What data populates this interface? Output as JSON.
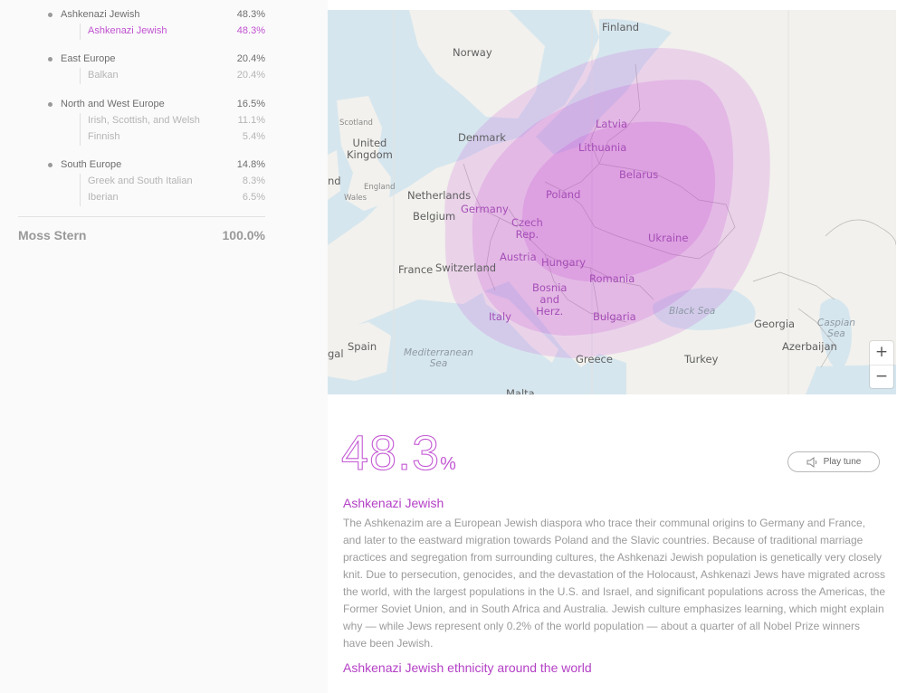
{
  "breakdown": {
    "regions": [
      {
        "name": "Ashkenazi Jewish",
        "pct": "48.3%",
        "subs": [
          {
            "name": "Ashkenazi Jewish",
            "pct": "48.3%",
            "active": true
          }
        ]
      },
      {
        "name": "East Europe",
        "pct": "20.4%",
        "subs": [
          {
            "name": "Balkan",
            "pct": "20.4%"
          }
        ]
      },
      {
        "name": "North and West Europe",
        "pct": "16.5%",
        "subs": [
          {
            "name": "Irish, Scottish, and Welsh",
            "pct": "11.1%"
          },
          {
            "name": "Finnish",
            "pct": "5.4%"
          }
        ]
      },
      {
        "name": "South Europe",
        "pct": "14.8%",
        "subs": [
          {
            "name": "Greek and South Italian",
            "pct": "8.3%"
          },
          {
            "name": "Iberian",
            "pct": "6.5%"
          }
        ]
      }
    ],
    "total": {
      "name": "Moss Stern",
      "pct": "100.0%"
    }
  },
  "map": {
    "labels": {
      "finland": "Finland",
      "norway": "Norway",
      "scotland": "Scotland",
      "united_kingdom": "United\nKingdom",
      "ireland_partial": "nd",
      "england": "England",
      "wales": "Wales",
      "denmark": "Denmark",
      "latvia": "Latvia",
      "lithuania": "Lithuania",
      "belarus": "Belarus",
      "netherlands": "Netherlands",
      "belgium": "Belgium",
      "germany": "Germany",
      "poland": "Poland",
      "czech_rep": "Czech\nRep.",
      "ukraine": "Ukraine",
      "austria": "Austria",
      "hungary": "Hungary",
      "france": "France",
      "switzerland": "Switzerland",
      "romania": "Romania",
      "bosnia": "Bosnia\nand\nHerz.",
      "italy": "Italy",
      "bulgaria": "Bulgaria",
      "black_sea": "Black Sea",
      "georgia": "Georgia",
      "caspian_sea": "Caspian\nSea",
      "azerbaijan": "Azerbaijan",
      "spain": "Spain",
      "portugal_partial": "gal",
      "mediterranean_sea": "Mediterranean\nSea",
      "greece": "Greece",
      "turkey": "Turkey",
      "malta_partial": "Malta"
    },
    "zoom_in": "+",
    "zoom_out": "−",
    "highlight_color": "#c84fd8"
  },
  "detail": {
    "percent_number": "48.3",
    "percent_unit": "%",
    "play_tune_label": "Play tune",
    "title": "Ashkenazi Jewish",
    "description": "The Ashkenazim are a European Jewish diaspora who trace their communal origins to Germany and France, and later to the eastward migration towards Poland and the Slavic countries. Because of traditional marriage practices and segregation from surrounding cultures, the Ashkenazi Jewish population is genetically very closely knit. Due to persecution, genocides, and the devastation of the Holocaust, Ashkenazi Jews have migrated across the world, with the largest populations in the U.S. and Israel, and significant populations across the Americas, the Former Soviet Union, and in South Africa and Australia. Jewish culture emphasizes learning, which might explain why — while Jews represent only 0.2% of the world population — about a quarter of all Nobel Prize winners have been Jewish.",
    "world_link": "Ashkenazi Jewish ethnicity around the world"
  },
  "colors": {
    "accent": "#b440c6",
    "sidebar_bg": "#fafafa",
    "map_land": "#f2f1ed",
    "map_water": "#d6e6ee"
  }
}
